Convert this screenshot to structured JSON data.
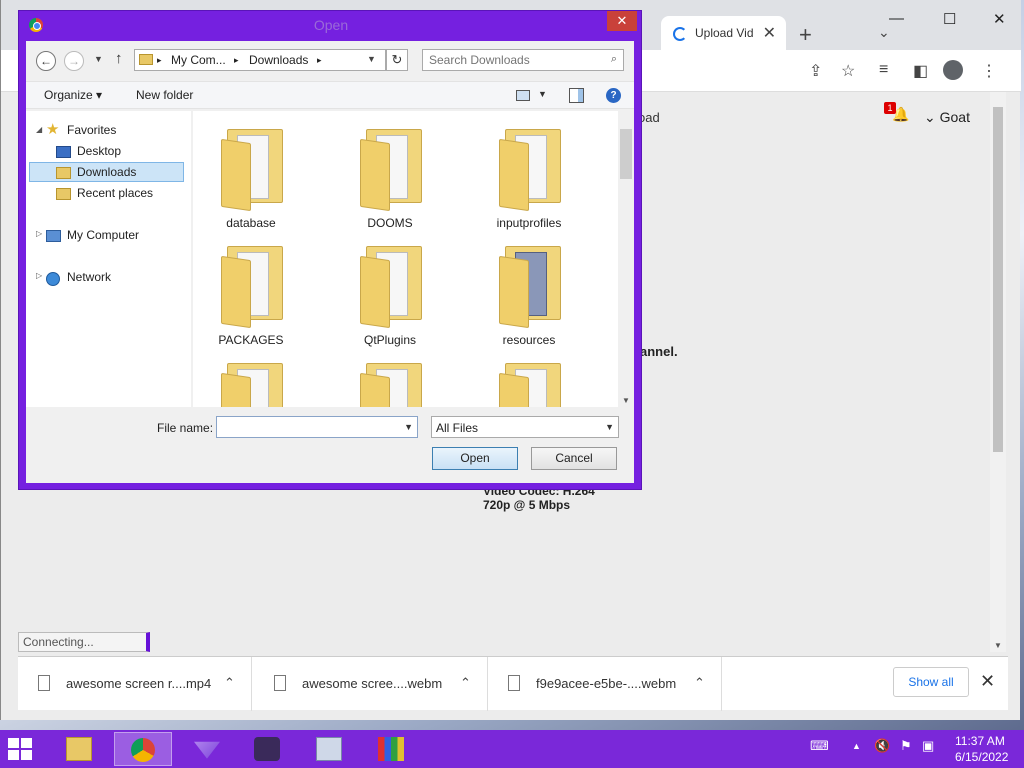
{
  "browser": {
    "tab_title": "Upload Vid",
    "tab_close": "✕",
    "new_tab": "+",
    "tab_list": "⌄",
    "minimize": "—",
    "maximize": "☐",
    "close": "✕"
  },
  "page": {
    "top_text": "oad",
    "user_name": "Goat",
    "user_chevron": "⌄",
    "notification_count": "1",
    "channel_text": "annel.",
    "codec_text": "Video Codec: H.264",
    "bitrate_text": "720p @ 5 Mbps"
  },
  "status_bubble": "Connecting...",
  "downloads": {
    "items": [
      {
        "name": "awesome screen r....mp4"
      },
      {
        "name": "awesome scree....webm"
      },
      {
        "name": "f9e9acee-e5be-....webm"
      }
    ],
    "show_all": "Show all",
    "close": "✕"
  },
  "dialog": {
    "title": "Open",
    "close": "✕",
    "address": {
      "seg1": "My Com...",
      "seg2": "Downloads"
    },
    "search_placeholder": "Search Downloads",
    "organize": "Organize ▾",
    "new_folder": "New folder",
    "help": "?",
    "nav": {
      "favorites": "Favorites",
      "desktop": "Desktop",
      "downloads": "Downloads",
      "recent": "Recent places",
      "my_computer": "My Computer",
      "network": "Network"
    },
    "folders": [
      "database",
      "DOOMS",
      "inputprofiles",
      "PACKAGES",
      "QtPlugins",
      "resources"
    ],
    "file_name_label": "File name:",
    "file_name_value": "",
    "filter": "All Files",
    "open": "Open",
    "cancel": "Cancel"
  },
  "taskbar": {
    "time": "11:37 AM",
    "date": "6/15/2022"
  },
  "colors": {
    "accent": "#7520e0",
    "taskbar": "#7a28d9",
    "selection": "#cce4f7"
  }
}
